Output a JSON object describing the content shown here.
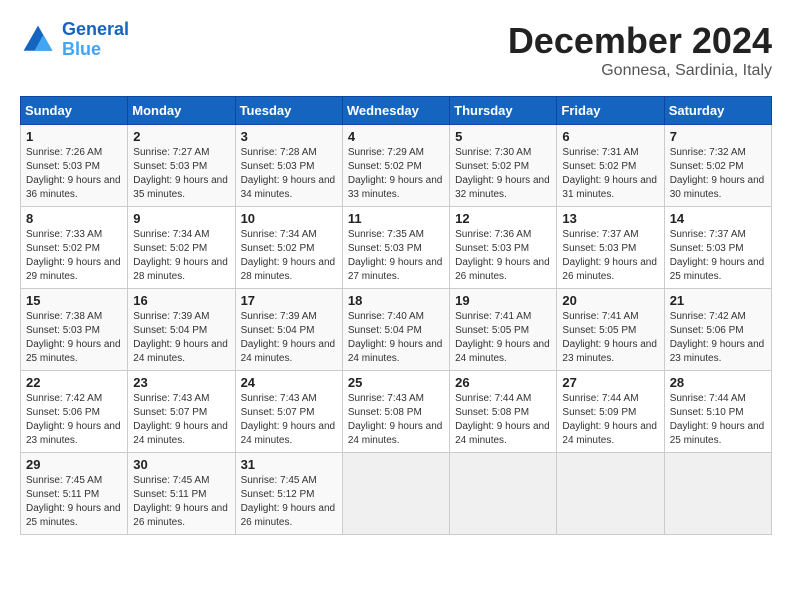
{
  "header": {
    "logo_line1": "General",
    "logo_line2": "Blue",
    "month": "December 2024",
    "location": "Gonnesa, Sardinia, Italy"
  },
  "weekdays": [
    "Sunday",
    "Monday",
    "Tuesday",
    "Wednesday",
    "Thursday",
    "Friday",
    "Saturday"
  ],
  "weeks": [
    [
      {
        "day": "1",
        "sunrise": "Sunrise: 7:26 AM",
        "sunset": "Sunset: 5:03 PM",
        "daylight": "Daylight: 9 hours and 36 minutes."
      },
      {
        "day": "2",
        "sunrise": "Sunrise: 7:27 AM",
        "sunset": "Sunset: 5:03 PM",
        "daylight": "Daylight: 9 hours and 35 minutes."
      },
      {
        "day": "3",
        "sunrise": "Sunrise: 7:28 AM",
        "sunset": "Sunset: 5:03 PM",
        "daylight": "Daylight: 9 hours and 34 minutes."
      },
      {
        "day": "4",
        "sunrise": "Sunrise: 7:29 AM",
        "sunset": "Sunset: 5:02 PM",
        "daylight": "Daylight: 9 hours and 33 minutes."
      },
      {
        "day": "5",
        "sunrise": "Sunrise: 7:30 AM",
        "sunset": "Sunset: 5:02 PM",
        "daylight": "Daylight: 9 hours and 32 minutes."
      },
      {
        "day": "6",
        "sunrise": "Sunrise: 7:31 AM",
        "sunset": "Sunset: 5:02 PM",
        "daylight": "Daylight: 9 hours and 31 minutes."
      },
      {
        "day": "7",
        "sunrise": "Sunrise: 7:32 AM",
        "sunset": "Sunset: 5:02 PM",
        "daylight": "Daylight: 9 hours and 30 minutes."
      }
    ],
    [
      {
        "day": "8",
        "sunrise": "Sunrise: 7:33 AM",
        "sunset": "Sunset: 5:02 PM",
        "daylight": "Daylight: 9 hours and 29 minutes."
      },
      {
        "day": "9",
        "sunrise": "Sunrise: 7:34 AM",
        "sunset": "Sunset: 5:02 PM",
        "daylight": "Daylight: 9 hours and 28 minutes."
      },
      {
        "day": "10",
        "sunrise": "Sunrise: 7:34 AM",
        "sunset": "Sunset: 5:02 PM",
        "daylight": "Daylight: 9 hours and 28 minutes."
      },
      {
        "day": "11",
        "sunrise": "Sunrise: 7:35 AM",
        "sunset": "Sunset: 5:03 PM",
        "daylight": "Daylight: 9 hours and 27 minutes."
      },
      {
        "day": "12",
        "sunrise": "Sunrise: 7:36 AM",
        "sunset": "Sunset: 5:03 PM",
        "daylight": "Daylight: 9 hours and 26 minutes."
      },
      {
        "day": "13",
        "sunrise": "Sunrise: 7:37 AM",
        "sunset": "Sunset: 5:03 PM",
        "daylight": "Daylight: 9 hours and 26 minutes."
      },
      {
        "day": "14",
        "sunrise": "Sunrise: 7:37 AM",
        "sunset": "Sunset: 5:03 PM",
        "daylight": "Daylight: 9 hours and 25 minutes."
      }
    ],
    [
      {
        "day": "15",
        "sunrise": "Sunrise: 7:38 AM",
        "sunset": "Sunset: 5:03 PM",
        "daylight": "Daylight: 9 hours and 25 minutes."
      },
      {
        "day": "16",
        "sunrise": "Sunrise: 7:39 AM",
        "sunset": "Sunset: 5:04 PM",
        "daylight": "Daylight: 9 hours and 24 minutes."
      },
      {
        "day": "17",
        "sunrise": "Sunrise: 7:39 AM",
        "sunset": "Sunset: 5:04 PM",
        "daylight": "Daylight: 9 hours and 24 minutes."
      },
      {
        "day": "18",
        "sunrise": "Sunrise: 7:40 AM",
        "sunset": "Sunset: 5:04 PM",
        "daylight": "Daylight: 9 hours and 24 minutes."
      },
      {
        "day": "19",
        "sunrise": "Sunrise: 7:41 AM",
        "sunset": "Sunset: 5:05 PM",
        "daylight": "Daylight: 9 hours and 24 minutes."
      },
      {
        "day": "20",
        "sunrise": "Sunrise: 7:41 AM",
        "sunset": "Sunset: 5:05 PM",
        "daylight": "Daylight: 9 hours and 23 minutes."
      },
      {
        "day": "21",
        "sunrise": "Sunrise: 7:42 AM",
        "sunset": "Sunset: 5:06 PM",
        "daylight": "Daylight: 9 hours and 23 minutes."
      }
    ],
    [
      {
        "day": "22",
        "sunrise": "Sunrise: 7:42 AM",
        "sunset": "Sunset: 5:06 PM",
        "daylight": "Daylight: 9 hours and 23 minutes."
      },
      {
        "day": "23",
        "sunrise": "Sunrise: 7:43 AM",
        "sunset": "Sunset: 5:07 PM",
        "daylight": "Daylight: 9 hours and 24 minutes."
      },
      {
        "day": "24",
        "sunrise": "Sunrise: 7:43 AM",
        "sunset": "Sunset: 5:07 PM",
        "daylight": "Daylight: 9 hours and 24 minutes."
      },
      {
        "day": "25",
        "sunrise": "Sunrise: 7:43 AM",
        "sunset": "Sunset: 5:08 PM",
        "daylight": "Daylight: 9 hours and 24 minutes."
      },
      {
        "day": "26",
        "sunrise": "Sunrise: 7:44 AM",
        "sunset": "Sunset: 5:08 PM",
        "daylight": "Daylight: 9 hours and 24 minutes."
      },
      {
        "day": "27",
        "sunrise": "Sunrise: 7:44 AM",
        "sunset": "Sunset: 5:09 PM",
        "daylight": "Daylight: 9 hours and 24 minutes."
      },
      {
        "day": "28",
        "sunrise": "Sunrise: 7:44 AM",
        "sunset": "Sunset: 5:10 PM",
        "daylight": "Daylight: 9 hours and 25 minutes."
      }
    ],
    [
      {
        "day": "29",
        "sunrise": "Sunrise: 7:45 AM",
        "sunset": "Sunset: 5:11 PM",
        "daylight": "Daylight: 9 hours and 25 minutes."
      },
      {
        "day": "30",
        "sunrise": "Sunrise: 7:45 AM",
        "sunset": "Sunset: 5:11 PM",
        "daylight": "Daylight: 9 hours and 26 minutes."
      },
      {
        "day": "31",
        "sunrise": "Sunrise: 7:45 AM",
        "sunset": "Sunset: 5:12 PM",
        "daylight": "Daylight: 9 hours and 26 minutes."
      },
      null,
      null,
      null,
      null
    ]
  ]
}
